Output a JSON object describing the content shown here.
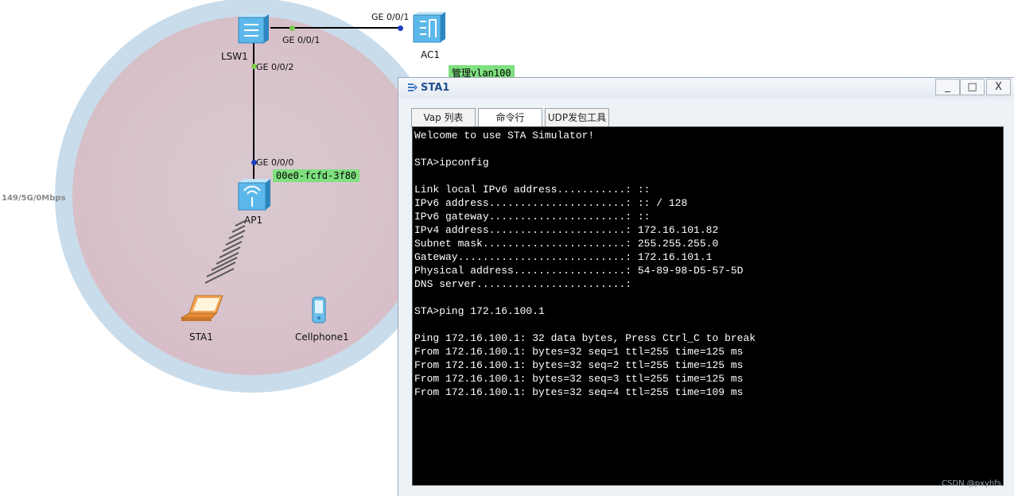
{
  "topology": {
    "side_label": "149/5G/0Mbps",
    "devices": {
      "lsw1": "LSW1",
      "ac1": "AC1",
      "ap1": "AP1",
      "sta1": "STA1",
      "cellphone1": "Cellphone1"
    },
    "ports": {
      "lsw1_ac1": "GE 0/0/1",
      "ac1_lsw1": "GE 0/0/1",
      "lsw1_ap1": "GE 0/0/2",
      "ap1_lsw1": "GE 0/0/0"
    },
    "tags": {
      "management": "管理vlan100",
      "ap_mac": "00e0-fcfd-3f80"
    },
    "colors": {
      "port_green": "#7ec850",
      "port_blue": "#1f3fbf",
      "tag_green": "#7ee07e"
    }
  },
  "window": {
    "title": "STA1",
    "icon": "sta-icon",
    "buttons": {
      "minimize": "_",
      "maximize": "□",
      "close": "X"
    },
    "tabs": [
      "Vap 列表",
      "命令行",
      "UDP发包工具"
    ],
    "console_lines": [
      "Welcome to use STA Simulator!",
      "",
      "STA>ipconfig",
      "",
      "Link local IPv6 address...........: ::",
      "IPv6 address......................: :: / 128",
      "IPv6 gateway......................: ::",
      "IPv4 address......................: 172.16.101.82",
      "Subnet mask.......................: 255.255.255.0",
      "Gateway...........................: 172.16.101.1",
      "Physical address..................: 54-89-98-D5-57-5D",
      "DNS server........................:",
      "",
      "STA>ping 172.16.100.1",
      "",
      "Ping 172.16.100.1: 32 data bytes, Press Ctrl_C to break",
      "From 172.16.100.1: bytes=32 seq=1 ttl=255 time=125 ms",
      "From 172.16.100.1: bytes=32 seq=2 ttl=255 time=125 ms",
      "From 172.16.100.1: bytes=32 seq=3 ttl=255 time=125 ms",
      "From 172.16.100.1: bytes=32 seq=4 ttl=255 time=109 ms"
    ]
  },
  "watermark": "CSDN @pxyhfs"
}
